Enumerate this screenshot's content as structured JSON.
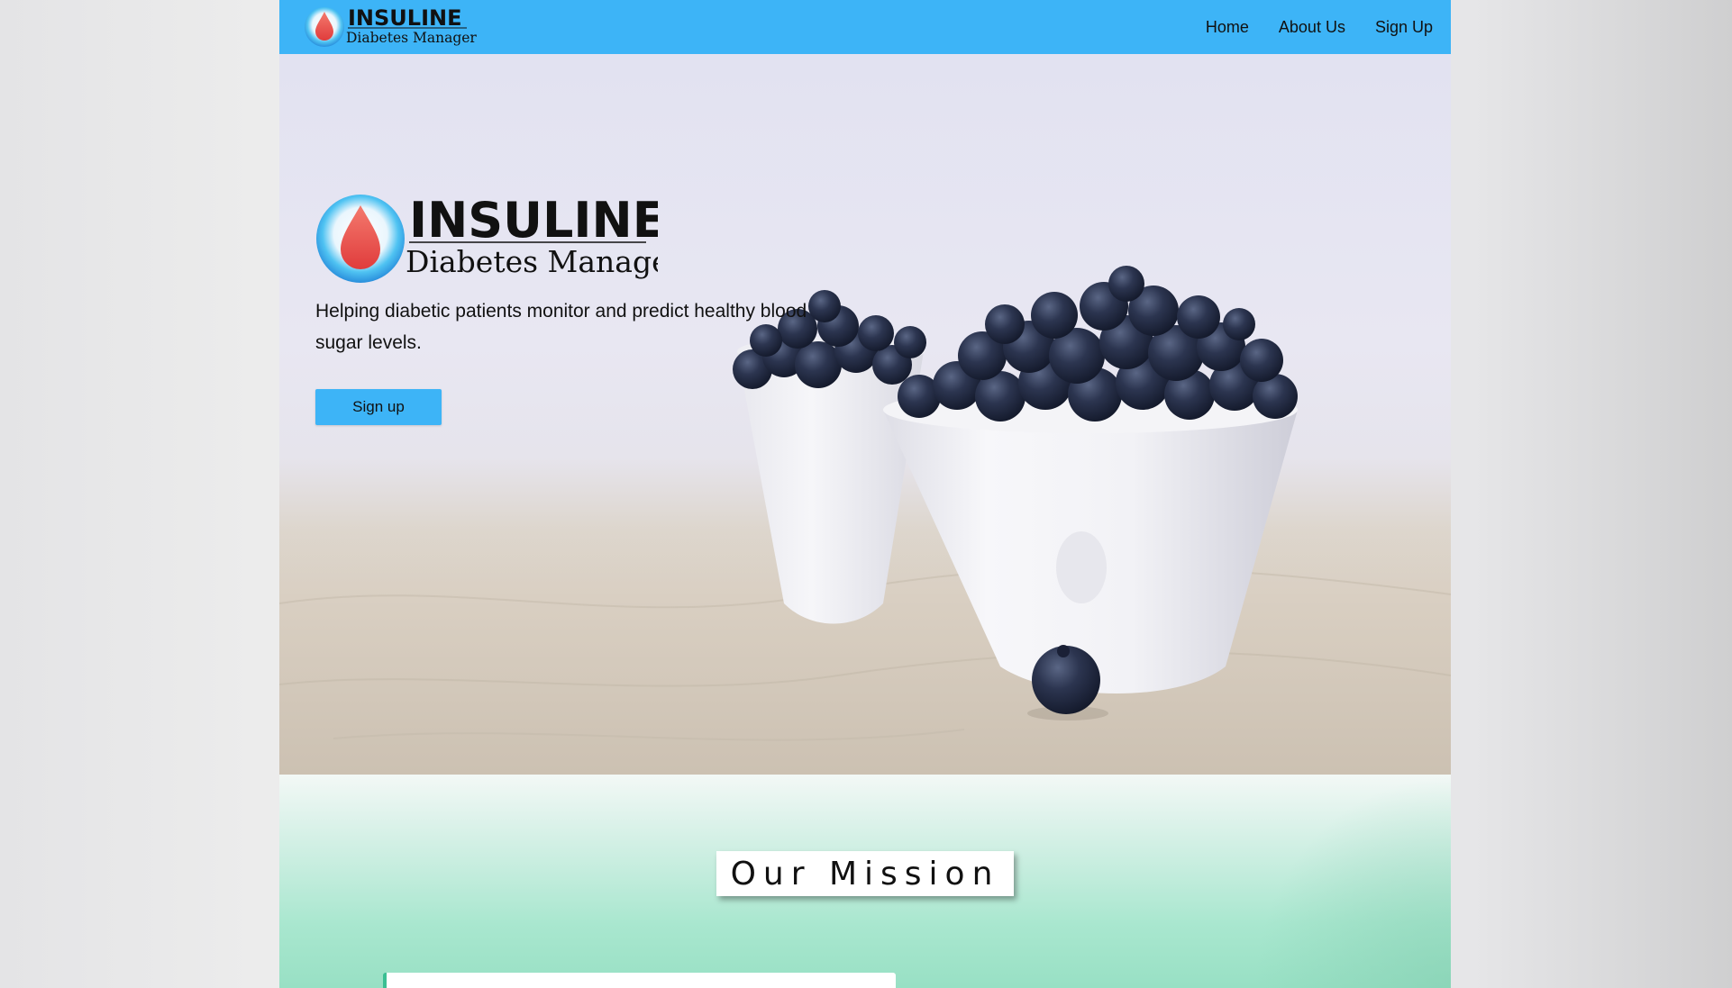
{
  "brand": {
    "name": "INSULINE",
    "subtitle": "Diabetes Manager",
    "colors": {
      "primary": "#3db4f7",
      "drop": "#ec4e4e",
      "mission_accent": "#3bbf93"
    }
  },
  "nav": {
    "links": [
      {
        "label": "Home"
      },
      {
        "label": "About Us"
      },
      {
        "label": "Sign Up"
      }
    ]
  },
  "hero": {
    "tagline": "Helping diabetic patients monitor and predict healthy blood sugar levels.",
    "cta_label": "Sign up",
    "image": "white bowls filled with blueberries on linen cloth"
  },
  "mission": {
    "title": "Our Mission"
  },
  "icons": {
    "logo": "blood-drop-icon"
  }
}
